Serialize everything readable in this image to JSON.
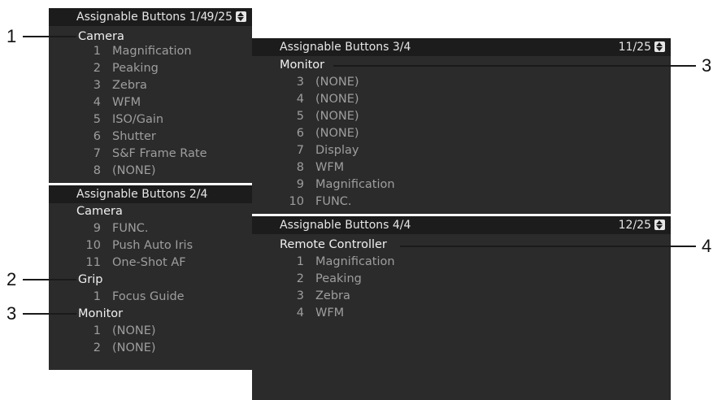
{
  "panel1": {
    "title": "Assignable Buttons 1/4",
    "page": "9/25",
    "category": "Camera",
    "items": [
      {
        "num": "1",
        "label": "Magnification"
      },
      {
        "num": "2",
        "label": "Peaking"
      },
      {
        "num": "3",
        "label": "Zebra"
      },
      {
        "num": "4",
        "label": "WFM"
      },
      {
        "num": "5",
        "label": "ISO/Gain"
      },
      {
        "num": "6",
        "label": "Shutter"
      },
      {
        "num": "7",
        "label": "S&F Frame Rate"
      },
      {
        "num": "8",
        "label": "(NONE)"
      }
    ]
  },
  "panel2": {
    "title": "Assignable Buttons 2/4",
    "cat_camera": "Camera",
    "camera_items": [
      {
        "num": "9",
        "label": "FUNC."
      },
      {
        "num": "10",
        "label": "Push Auto Iris"
      },
      {
        "num": "11",
        "label": "One-Shot AF"
      }
    ],
    "cat_grip": "Grip",
    "grip_items": [
      {
        "num": "1",
        "label": "Focus Guide"
      }
    ],
    "cat_monitor": "Monitor",
    "monitor_items": [
      {
        "num": "1",
        "label": "(NONE)"
      },
      {
        "num": "2",
        "label": "(NONE)"
      }
    ]
  },
  "panel3": {
    "title": "Assignable Buttons 3/4",
    "page": "11/25",
    "category": "Monitor",
    "items": [
      {
        "num": "3",
        "label": "(NONE)"
      },
      {
        "num": "4",
        "label": "(NONE)"
      },
      {
        "num": "5",
        "label": "(NONE)"
      },
      {
        "num": "6",
        "label": "(NONE)"
      },
      {
        "num": "7",
        "label": "Display"
      },
      {
        "num": "8",
        "label": "WFM"
      },
      {
        "num": "9",
        "label": "Magnification"
      },
      {
        "num": "10",
        "label": "FUNC."
      }
    ]
  },
  "panel4": {
    "title": "Assignable Buttons 4/4",
    "page": "12/25",
    "category": "Remote Controller",
    "items": [
      {
        "num": "1",
        "label": "Magnification"
      },
      {
        "num": "2",
        "label": "Peaking"
      },
      {
        "num": "3",
        "label": "Zebra"
      },
      {
        "num": "4",
        "label": "WFM"
      }
    ]
  },
  "callouts": [
    "1",
    "2",
    "3",
    "3",
    "4"
  ],
  "icons": {
    "page_arrows": "up-down-arrow-icon"
  }
}
